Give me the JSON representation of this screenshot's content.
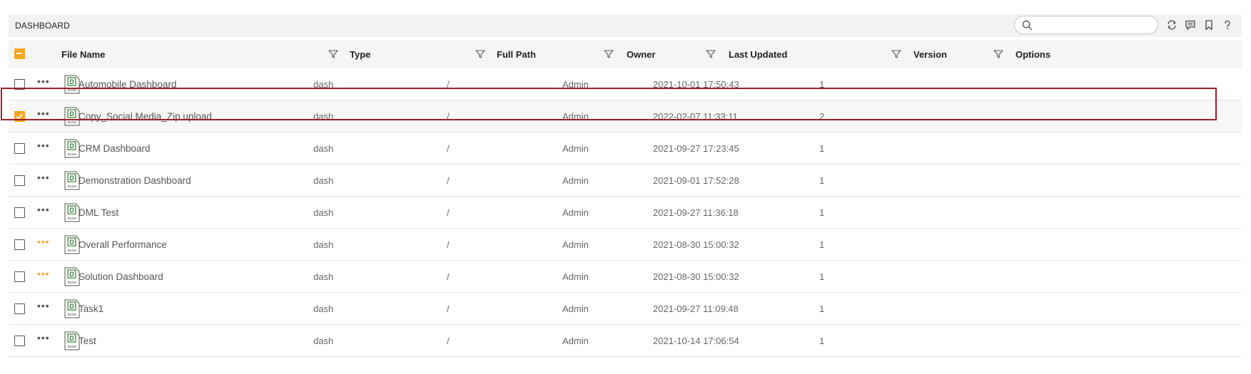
{
  "header": {
    "title": "DASHBOARD",
    "search": {
      "value": "",
      "placeholder": ""
    }
  },
  "toolbar_icons": [
    "refresh-icon",
    "comment-icon",
    "bookmark-icon",
    "help-icon"
  ],
  "colors": {
    "accent": "#f5a623",
    "selection_border": "#a31d2b",
    "file_icon": "#2e7d32"
  },
  "columns": [
    {
      "key": "file_name",
      "label": "File Name"
    },
    {
      "key": "type",
      "label": "Type"
    },
    {
      "key": "full_path",
      "label": "Full Path"
    },
    {
      "key": "owner",
      "label": "Owner"
    },
    {
      "key": "last_updated",
      "label": "Last Updated"
    },
    {
      "key": "version",
      "label": "Version"
    },
    {
      "key": "options",
      "label": "Options"
    }
  ],
  "file_icon_label": "DASH",
  "rows": [
    {
      "name": "Automobile Dashboard",
      "type": "dash",
      "path": "/",
      "owner": "Admin",
      "updated": "2021-10-01 17:50:43",
      "version": "1",
      "checked": false,
      "dots_highlight": false
    },
    {
      "name": "Copy_Social Media_Zip upload",
      "type": "dash",
      "path": "/",
      "owner": "Admin",
      "updated": "2022-02-07 11:33:11",
      "version": "2",
      "checked": true,
      "dots_highlight": false
    },
    {
      "name": "CRM Dashboard",
      "type": "dash",
      "path": "/",
      "owner": "Admin",
      "updated": "2021-09-27 17:23:45",
      "version": "1",
      "checked": false,
      "dots_highlight": false
    },
    {
      "name": "Demonstration Dashboard",
      "type": "dash",
      "path": "/",
      "owner": "Admin",
      "updated": "2021-09-01 17:52:28",
      "version": "1",
      "checked": false,
      "dots_highlight": false
    },
    {
      "name": "DML Test",
      "type": "dash",
      "path": "/",
      "owner": "Admin",
      "updated": "2021-09-27 11:36:18",
      "version": "1",
      "checked": false,
      "dots_highlight": false
    },
    {
      "name": "Overall Performance",
      "type": "dash",
      "path": "/",
      "owner": "Admin",
      "updated": "2021-08-30 15:00:32",
      "version": "1",
      "checked": false,
      "dots_highlight": true
    },
    {
      "name": "Solution Dashboard",
      "type": "dash",
      "path": "/",
      "owner": "Admin",
      "updated": "2021-08-30 15:00:32",
      "version": "1",
      "checked": false,
      "dots_highlight": true
    },
    {
      "name": "Task1",
      "type": "dash",
      "path": "/",
      "owner": "Admin",
      "updated": "2021-09-27 11:09:48",
      "version": "1",
      "checked": false,
      "dots_highlight": false
    },
    {
      "name": "Test",
      "type": "dash",
      "path": "/",
      "owner": "Admin",
      "updated": "2021-10-14 17:06:54",
      "version": "1",
      "checked": false,
      "dots_highlight": false
    }
  ]
}
